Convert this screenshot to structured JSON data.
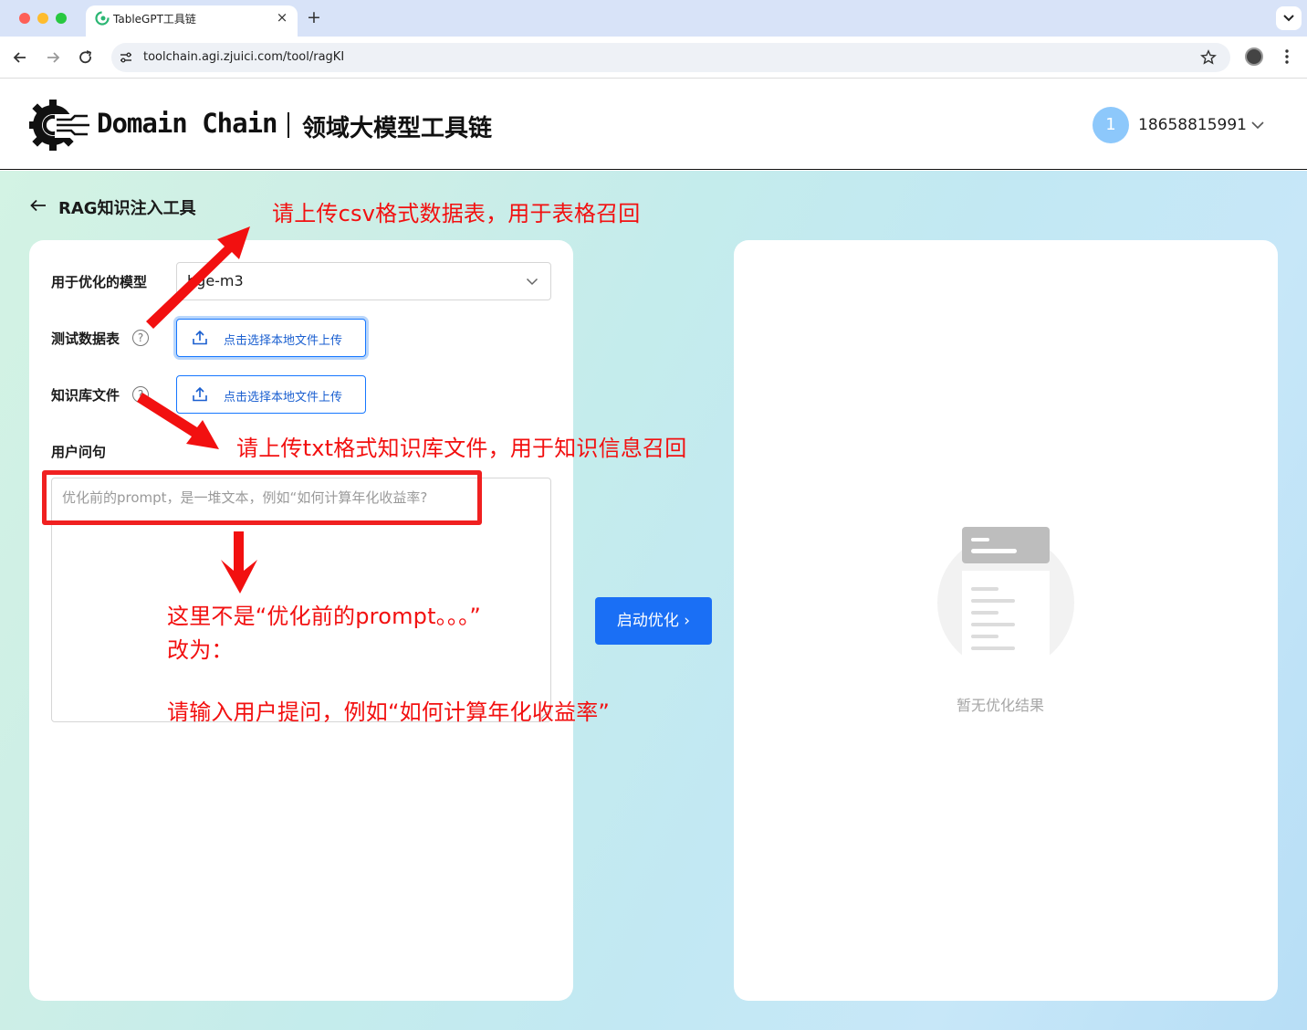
{
  "browser": {
    "tab_title": "TableGPT工具链",
    "url": "toolchain.agi.zjuici.com/tool/ragKI",
    "tab_close": "×",
    "new_tab": "+"
  },
  "header": {
    "brand": "Domain Chain",
    "brand_cn": "领域大模型工具链",
    "user_initial": "1",
    "user_phone": "18658815991"
  },
  "page": {
    "title": "RAG知识注入工具"
  },
  "form": {
    "model_label": "用于优化的模型",
    "model_value": "bge-m3",
    "test_table_label": "测试数据表",
    "kb_label": "知识库文件",
    "upload_label": "点击选择本地文件上传",
    "help_glyph": "?",
    "question_label": "用户问句",
    "question_placeholder": "优化前的prompt，是一堆文本，例如“如何计算年化收益率?",
    "start_button": "启动优化 ›"
  },
  "result": {
    "empty_text": "暂无优化结果"
  },
  "annotations": {
    "csv_note": "请上传csv格式数据表，用于表格召回",
    "txt_note": "请上传txt格式知识库文件，用于知识信息召回",
    "prompt_note_line1": "这里不是“优化前的prompt。。。”",
    "prompt_note_line2": "改为：",
    "prompt_note_line3": "请输入用户提问，例如“如何计算年化收益率”",
    "color": "#f21010"
  },
  "colors": {
    "primary": "#1a6ff5",
    "avatar": "#8dc8fb"
  }
}
